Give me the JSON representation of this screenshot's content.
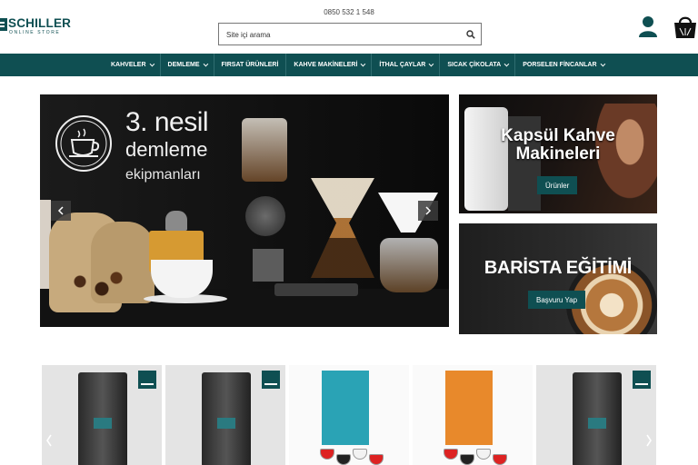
{
  "header": {
    "phone": "0850 532 1 548",
    "logo": {
      "brand": "SCHILLER",
      "sub": "ONLINE STORE"
    },
    "search": {
      "placeholder": "Site içi arama"
    },
    "icons": {
      "search": "search-icon",
      "user": "user-icon",
      "cart": "shopping-bag-icon"
    }
  },
  "nav": {
    "items": [
      {
        "label": "KAHVELER",
        "has_dropdown": true
      },
      {
        "label": "DEMLEME",
        "has_dropdown": true
      },
      {
        "label": "FIRSAT ÜRÜNLERİ",
        "has_dropdown": false
      },
      {
        "label": "KAHVE MAKİNELERİ",
        "has_dropdown": true
      },
      {
        "label": "İTHAL ÇAYLAR",
        "has_dropdown": true
      },
      {
        "label": "SICAK ÇİKOLATA",
        "has_dropdown": true
      },
      {
        "label": "PORSELEN FİNCANLAR",
        "has_dropdown": true
      }
    ]
  },
  "hero": {
    "line1": "3. nesil",
    "line2": "demleme",
    "line3": "ekipmanları"
  },
  "side_banners": [
    {
      "title": "Kapsül Kahve Makineleri",
      "button": "Ürünler"
    },
    {
      "title": "BARİSTA EĞİTİMİ",
      "button": "Başvuru Yap"
    }
  ],
  "products": [
    {
      "type": "bag",
      "badge": "SCHILLER"
    },
    {
      "type": "bag",
      "badge": "SCHILLER"
    },
    {
      "type": "capsule-box",
      "color": "#2aa3b5"
    },
    {
      "type": "capsule-box",
      "color": "#e8892b"
    },
    {
      "type": "bag",
      "badge": "SCHILLER"
    }
  ],
  "colors": {
    "brand": "#0f4f52",
    "nav_text": "#ffffff"
  }
}
